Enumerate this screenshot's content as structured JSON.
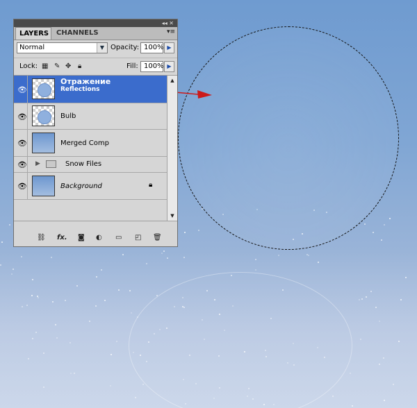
{
  "panel": {
    "tabs": [
      {
        "label": "LAYERS",
        "active": true
      },
      {
        "label": "CHANNELS",
        "active": false
      }
    ],
    "blend_mode": "Normal",
    "opacity_label": "Opacity:",
    "opacity_value": "100%",
    "lock_label": "Lock:",
    "fill_label": "Fill:",
    "fill_value": "100%",
    "layers": [
      {
        "name": "Отражение",
        "subtitle": "Reflections",
        "thumb": "checker-ball",
        "selected": true
      },
      {
        "name": "Bulb",
        "thumb": "checker-ball",
        "selected": false
      },
      {
        "name": "Merged Comp",
        "thumb": "blue",
        "selected": false
      },
      {
        "name": "Snow Files",
        "type": "group",
        "selected": false
      },
      {
        "name": "Background",
        "thumb": "blue",
        "italic": true,
        "locked": true,
        "selected": false
      }
    ],
    "footer_icons": [
      "link-icon",
      "fx-icon",
      "mask-icon",
      "adjustment-icon",
      "folder-icon",
      "new-layer-icon",
      "trash-icon"
    ]
  },
  "colors": {
    "selection_blue": "#3b6ccc",
    "arrow_red": "#cc1a1a"
  }
}
